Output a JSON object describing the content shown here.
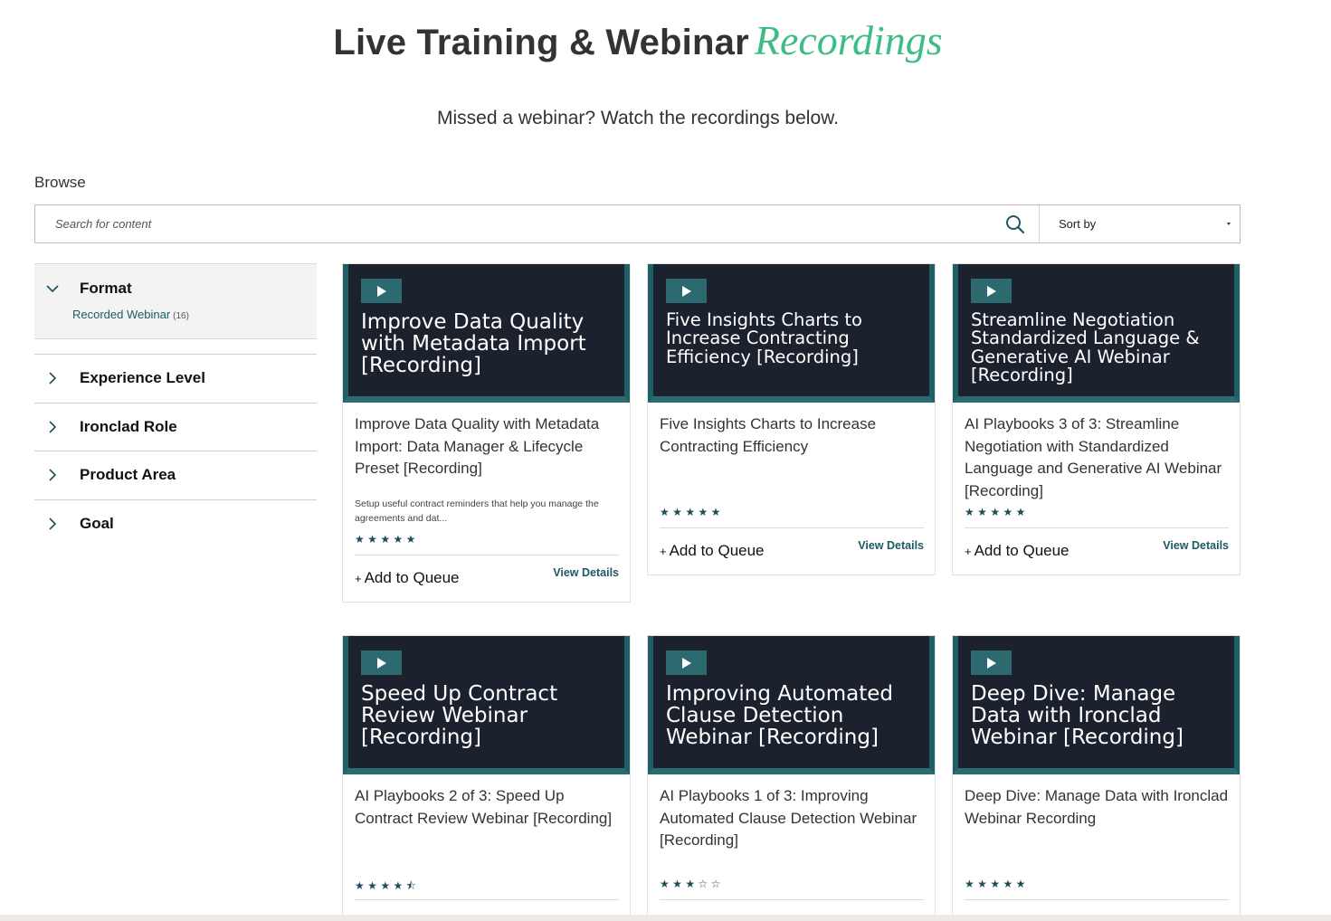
{
  "header": {
    "title_main": "Live Training & Webinar",
    "title_accent": "Recordings",
    "subtitle": "Missed a webinar? Watch the recordings below.",
    "accent_color": "#3dbd86"
  },
  "browse": {
    "label": "Browse",
    "search_placeholder": "Search for content",
    "search_icon": "search-icon",
    "sort_label": "Sort by"
  },
  "filters": {
    "format": {
      "label": "Format",
      "expanded": true,
      "options": [
        {
          "label": "Recorded Webinar",
          "count": "(16)"
        }
      ]
    },
    "collapsed": [
      {
        "label": "Experience Level"
      },
      {
        "label": "Ironclad Role"
      },
      {
        "label": "Product Area"
      },
      {
        "label": "Goal"
      }
    ]
  },
  "cards": [
    {
      "thumb_title": "Improve Data Quality with Metadata Import [Recording]",
      "title": "Improve Data Quality with Metadata Import: Data Manager & Lifecycle Preset [Recording]",
      "description": "Setup useful contract reminders that help you manage the agreements and dat...",
      "rating": 5,
      "stars": "★★★★★",
      "queue_label": "Add to Queue",
      "details_label": "View Details"
    },
    {
      "thumb_title": "Five Insights Charts to Increase Contracting Efficiency [Recording]",
      "title": "Five Insights Charts to Increase Contracting Efficiency",
      "rating": 5,
      "stars": "★★★★★",
      "queue_label": "Add to Queue",
      "details_label": "View Details"
    },
    {
      "thumb_title": "Streamline Negotiation Standardized Language & Generative AI Webinar [Recording]",
      "title": "AI Playbooks 3 of 3: Streamline Negotiation with Standardized Language and Generative AI Webinar [Recording]",
      "rating": 5,
      "stars": "★★★★★",
      "queue_label": "Add to Queue",
      "details_label": "View Details"
    },
    {
      "thumb_title": "Speed Up Contract Review Webinar [Recording]",
      "title": "AI Playbooks 2 of 3: Speed Up Contract Review Webinar [Recording]",
      "rating": 4.5,
      "stars": "★★★★⯪"
    },
    {
      "thumb_title": "Improving Automated Clause Detection Webinar [Recording]",
      "title": "AI Playbooks 1 of 3: Improving Automated Clause Detection Webinar [Recording]",
      "rating": 3,
      "stars": "★★★☆☆"
    },
    {
      "thumb_title": "Deep Dive: Manage Data with Ironclad Webinar [Recording]",
      "title": "Deep Dive: Manage Data with Ironclad Webinar Recording",
      "rating": 5,
      "stars": "★★★★★"
    }
  ]
}
